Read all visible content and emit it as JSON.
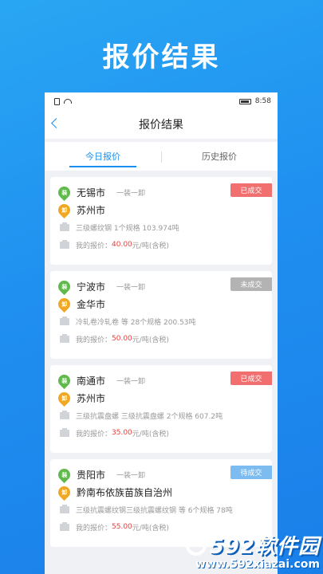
{
  "promo_title": "报价结果",
  "statusbar": {
    "time": "8:58"
  },
  "navbar": {
    "title": "报价结果"
  },
  "tabs": [
    {
      "label": "今日报价",
      "active": true
    },
    {
      "label": "历史报价",
      "active": false
    }
  ],
  "cards": [
    {
      "from": "无锡市",
      "to": "苏州市",
      "mode": "一装一卸",
      "status": "已成交",
      "status_color": "#f26f6f",
      "goods": "三级螺纹钢  1个规格 103.974吨",
      "price_label": "我的报价：",
      "price": "40.00",
      "price_unit": "元/吨(含税)"
    },
    {
      "from": "宁波市",
      "to": "金华市",
      "mode": "一装一卸",
      "status": "未成交",
      "status_color": "#b3b3b3",
      "goods": "冷轧卷冷轧卷 等 28个规格 200.53吨",
      "price_label": "我的报价：",
      "price": "50.00",
      "price_unit": "元/吨(含税)"
    },
    {
      "from": "南通市",
      "to": "苏州市",
      "mode": "一装一卸",
      "status": "已成交",
      "status_color": "#f26f6f",
      "goods": "三级抗震盘螺  三级抗震盘螺  2个规格 607.2吨",
      "price_label": "我的报价：",
      "price": "35.00",
      "price_unit": "元/吨(含税)"
    },
    {
      "from": "贵阳市",
      "to": "黔南布依族苗族自治州",
      "mode": "一装一卸",
      "status": "待成交",
      "status_color": "#7dbcf0",
      "goods": "三级抗震螺纹钢三级抗震螺纹钢 等 6个规格 78吨",
      "price_label": "我的报价：",
      "price": "55.00",
      "price_unit": "元/吨(含税)"
    }
  ],
  "pin_labels": {
    "from": "装",
    "to": "卸"
  },
  "watermark": {
    "brand": "592软件园",
    "url": "www.592xiazai.com"
  }
}
